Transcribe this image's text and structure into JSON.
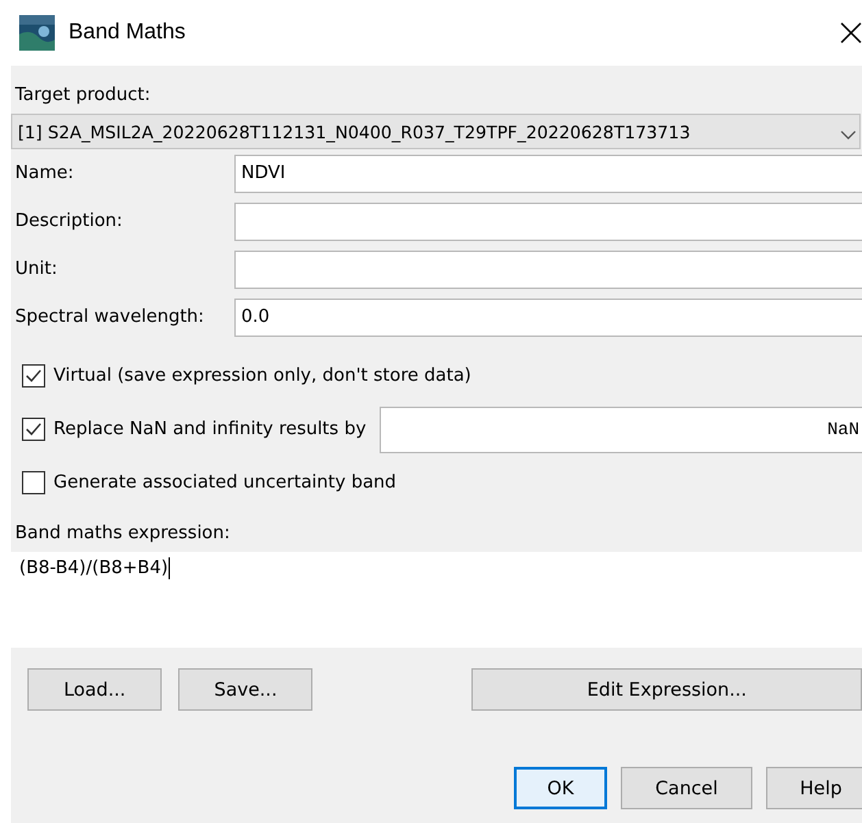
{
  "window": {
    "title": "Band Maths"
  },
  "target_product": {
    "label": "Target product:",
    "value": "[1] S2A_MSIL2A_20220628T112131_N0400_R037_T29TPF_20220628T173713"
  },
  "fields": [
    {
      "label": "Name:",
      "value": "NDVI"
    },
    {
      "label": "Description:"
    },
    {
      "label": "Unit:"
    },
    {
      "label": "Spectral wavelength:",
      "value": "0.0"
    }
  ],
  "options": [
    {
      "kind": "checkbox",
      "label": "Virtual (save expression only, don't store data)",
      "checked": true
    },
    {
      "kind": "checkbox-field",
      "label": "Replace NaN and infinity results by",
      "checked": true,
      "value": "NaN"
    },
    {
      "kind": "checkbox",
      "label": "Generate associated uncertainty band",
      "checked": false
    }
  ],
  "expression": {
    "label": "Band maths expression:",
    "value": "(B8-B4)/(B8+B4)"
  },
  "expression_buttons": [
    {
      "label": "Load...",
      "kind": "small"
    },
    {
      "label": "Save...",
      "kind": "small"
    },
    {
      "label": "Edit Expression...",
      "kind": "wide"
    }
  ],
  "dialog_buttons": [
    {
      "label": "OK",
      "default": true
    },
    {
      "label": "Cancel",
      "default": false
    },
    {
      "label": "Help",
      "default": false
    }
  ]
}
